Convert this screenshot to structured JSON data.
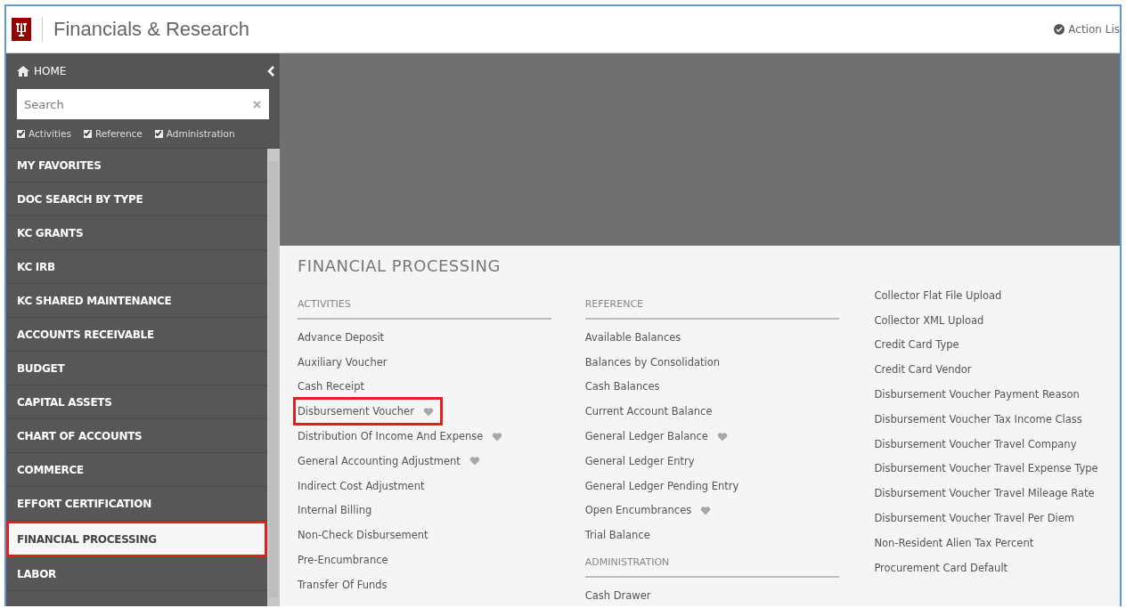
{
  "header": {
    "title": "Financials & Research",
    "action_list": "Action Lis"
  },
  "sidebar": {
    "home": "HOME",
    "search": {
      "placeholder": "Search"
    },
    "filters": [
      {
        "label": "Activities",
        "checked": true
      },
      {
        "label": "Reference",
        "checked": true
      },
      {
        "label": "Administration",
        "checked": true
      }
    ],
    "items": [
      {
        "label": "MY FAVORITES",
        "selected": false
      },
      {
        "label": "DOC SEARCH BY TYPE",
        "selected": false
      },
      {
        "label": "KC GRANTS",
        "selected": false
      },
      {
        "label": "KC IRB",
        "selected": false
      },
      {
        "label": "KC SHARED MAINTENANCE",
        "selected": false
      },
      {
        "label": "ACCOUNTS RECEIVABLE",
        "selected": false
      },
      {
        "label": "BUDGET",
        "selected": false
      },
      {
        "label": "CAPITAL ASSETS",
        "selected": false
      },
      {
        "label": "CHART OF ACCOUNTS",
        "selected": false
      },
      {
        "label": "COMMERCE",
        "selected": false
      },
      {
        "label": "EFFORT CERTIFICATION",
        "selected": false
      },
      {
        "label": "FINANCIAL PROCESSING",
        "selected": true
      },
      {
        "label": "LABOR",
        "selected": false
      }
    ]
  },
  "content": {
    "title": "FINANCIAL PROCESSING",
    "columns": [
      {
        "sections": [
          {
            "heading": "ACTIVITIES",
            "links": [
              {
                "label": "Advance Deposit",
                "favorite": false,
                "highlighted": false
              },
              {
                "label": "Auxiliary Voucher",
                "favorite": false,
                "highlighted": false
              },
              {
                "label": "Cash Receipt",
                "favorite": false,
                "highlighted": false
              },
              {
                "label": "Disbursement Voucher",
                "favorite": true,
                "highlighted": true
              },
              {
                "label": "Distribution Of Income And Expense",
                "favorite": true,
                "highlighted": false
              },
              {
                "label": "General Accounting Adjustment",
                "favorite": true,
                "highlighted": false
              },
              {
                "label": "Indirect Cost Adjustment",
                "favorite": false,
                "highlighted": false
              },
              {
                "label": "Internal Billing",
                "favorite": false,
                "highlighted": false
              },
              {
                "label": "Non-Check Disbursement",
                "favorite": false,
                "highlighted": false
              },
              {
                "label": "Pre-Encumbrance",
                "favorite": false,
                "highlighted": false
              },
              {
                "label": "Transfer Of Funds",
                "favorite": false,
                "highlighted": false
              }
            ]
          }
        ]
      },
      {
        "sections": [
          {
            "heading": "REFERENCE",
            "links": [
              {
                "label": "Available Balances",
                "favorite": false,
                "highlighted": false
              },
              {
                "label": "Balances by Consolidation",
                "favorite": false,
                "highlighted": false
              },
              {
                "label": "Cash Balances",
                "favorite": false,
                "highlighted": false
              },
              {
                "label": "Current Account Balance",
                "favorite": false,
                "highlighted": false
              },
              {
                "label": "General Ledger Balance",
                "favorite": true,
                "highlighted": false
              },
              {
                "label": "General Ledger Entry",
                "favorite": false,
                "highlighted": false
              },
              {
                "label": "General Ledger Pending Entry",
                "favorite": false,
                "highlighted": false
              },
              {
                "label": "Open Encumbrances",
                "favorite": true,
                "highlighted": false
              },
              {
                "label": "Trial Balance",
                "favorite": false,
                "highlighted": false
              }
            ]
          },
          {
            "heading": "ADMINISTRATION",
            "links": [
              {
                "label": "Cash Drawer",
                "favorite": false,
                "highlighted": false
              }
            ]
          }
        ]
      },
      {
        "sections": [
          {
            "links": [
              {
                "label": "Collector Flat File Upload",
                "favorite": false,
                "highlighted": false
              },
              {
                "label": "Collector XML Upload",
                "favorite": false,
                "highlighted": false
              },
              {
                "label": "Credit Card Type",
                "favorite": false,
                "highlighted": false
              },
              {
                "label": "Credit Card Vendor",
                "favorite": false,
                "highlighted": false
              },
              {
                "label": "Disbursement Voucher Payment Reason",
                "favorite": false,
                "highlighted": false
              },
              {
                "label": "Disbursement Voucher Tax Income Class",
                "favorite": false,
                "highlighted": false
              },
              {
                "label": "Disbursement Voucher Travel Company",
                "favorite": false,
                "highlighted": false
              },
              {
                "label": "Disbursement Voucher Travel Expense Type",
                "favorite": false,
                "highlighted": false
              },
              {
                "label": "Disbursement Voucher Travel Mileage Rate",
                "favorite": false,
                "highlighted": false
              },
              {
                "label": "Disbursement Voucher Travel Per Diem",
                "favorite": false,
                "highlighted": false
              },
              {
                "label": "Non-Resident Alien Tax Percent",
                "favorite": false,
                "highlighted": false
              },
              {
                "label": "Procurement Card Default",
                "favorite": false,
                "highlighted": false
              }
            ]
          }
        ]
      }
    ]
  }
}
